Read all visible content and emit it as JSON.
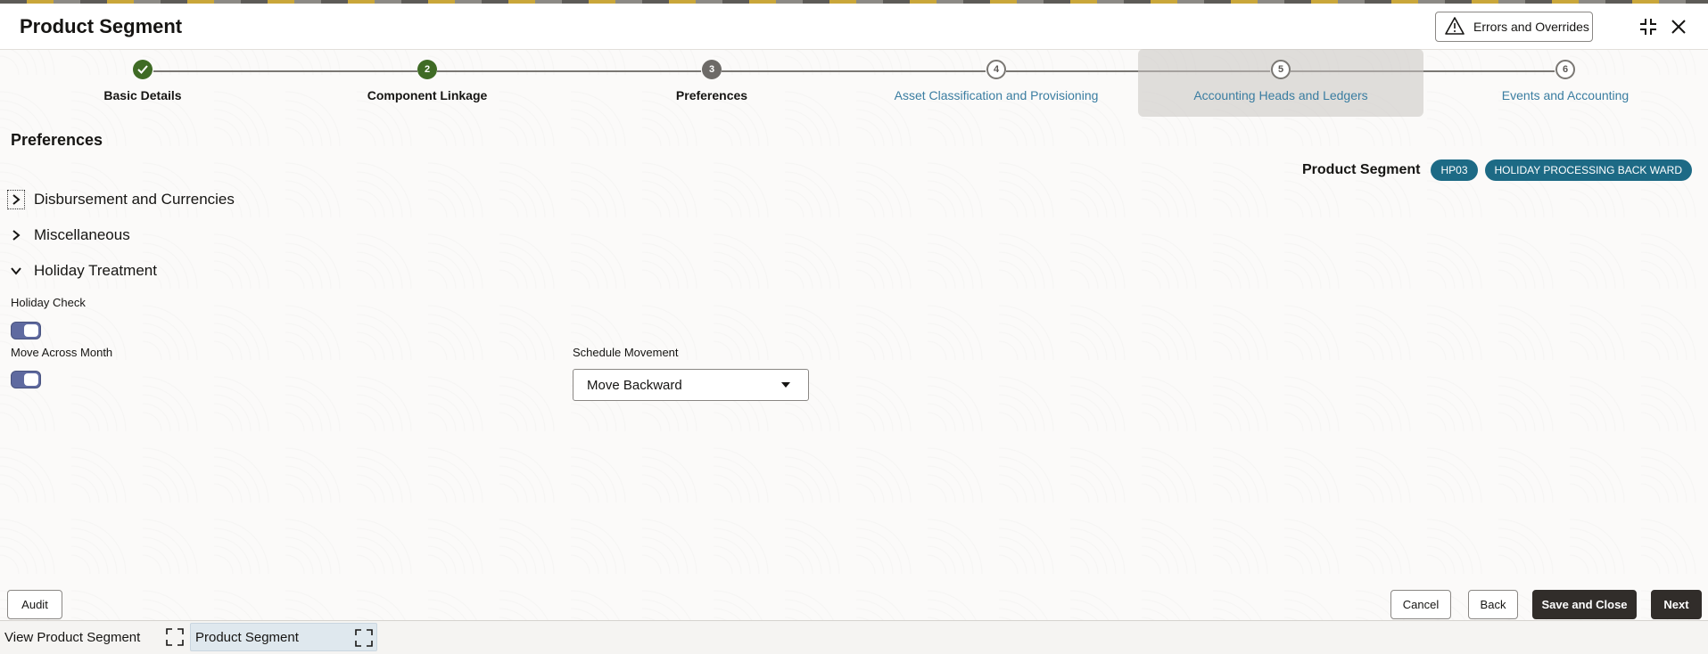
{
  "header": {
    "title": "Product Segment",
    "errors_button": "Errors and Overrides",
    "icons": [
      "warning-icon",
      "collapse-icon",
      "close-icon"
    ]
  },
  "stepper": {
    "steps": [
      {
        "number": "1",
        "label": "Basic Details",
        "state": "done"
      },
      {
        "number": "2",
        "label": "Component Linkage",
        "state": "done"
      },
      {
        "number": "3",
        "label": "Preferences",
        "state": "current"
      },
      {
        "number": "4",
        "label": "Asset Classification and Provisioning",
        "state": "todo"
      },
      {
        "number": "5",
        "label": "Accounting Heads and Ledgers",
        "state": "todo"
      },
      {
        "number": "6",
        "label": "Events and Accounting",
        "state": "todo"
      }
    ]
  },
  "main": {
    "section_title": "Preferences",
    "product_segment_label": "Product Segment",
    "product_code": "HP03",
    "product_name": "HOLIDAY PROCESSING BACK WARD",
    "accordions": [
      {
        "label": "Disbursement and Currencies",
        "expanded": false
      },
      {
        "label": "Miscellaneous",
        "expanded": false
      },
      {
        "label": "Holiday Treatment",
        "expanded": true
      }
    ],
    "holiday": {
      "holiday_check_label": "Holiday Check",
      "holiday_check_on": true,
      "move_across_month_label": "Move Across Month",
      "move_across_month_on": true,
      "schedule_movement_label": "Schedule Movement",
      "schedule_movement_value": "Move Backward"
    }
  },
  "footer": {
    "audit": "Audit",
    "cancel": "Cancel",
    "back": "Back",
    "save_close": "Save and Close",
    "next": "Next"
  },
  "taskbar": {
    "tabs": [
      {
        "label": "View Product Segment",
        "active": false
      },
      {
        "label": "Product Segment",
        "active": true
      }
    ]
  },
  "colors": {
    "done": "#3f6b25",
    "current": "#6d6a67",
    "link": "#3a7da1",
    "badge": "#1d6a85",
    "toggle": "#5f6aa0",
    "primary_button": "#312d2a"
  }
}
